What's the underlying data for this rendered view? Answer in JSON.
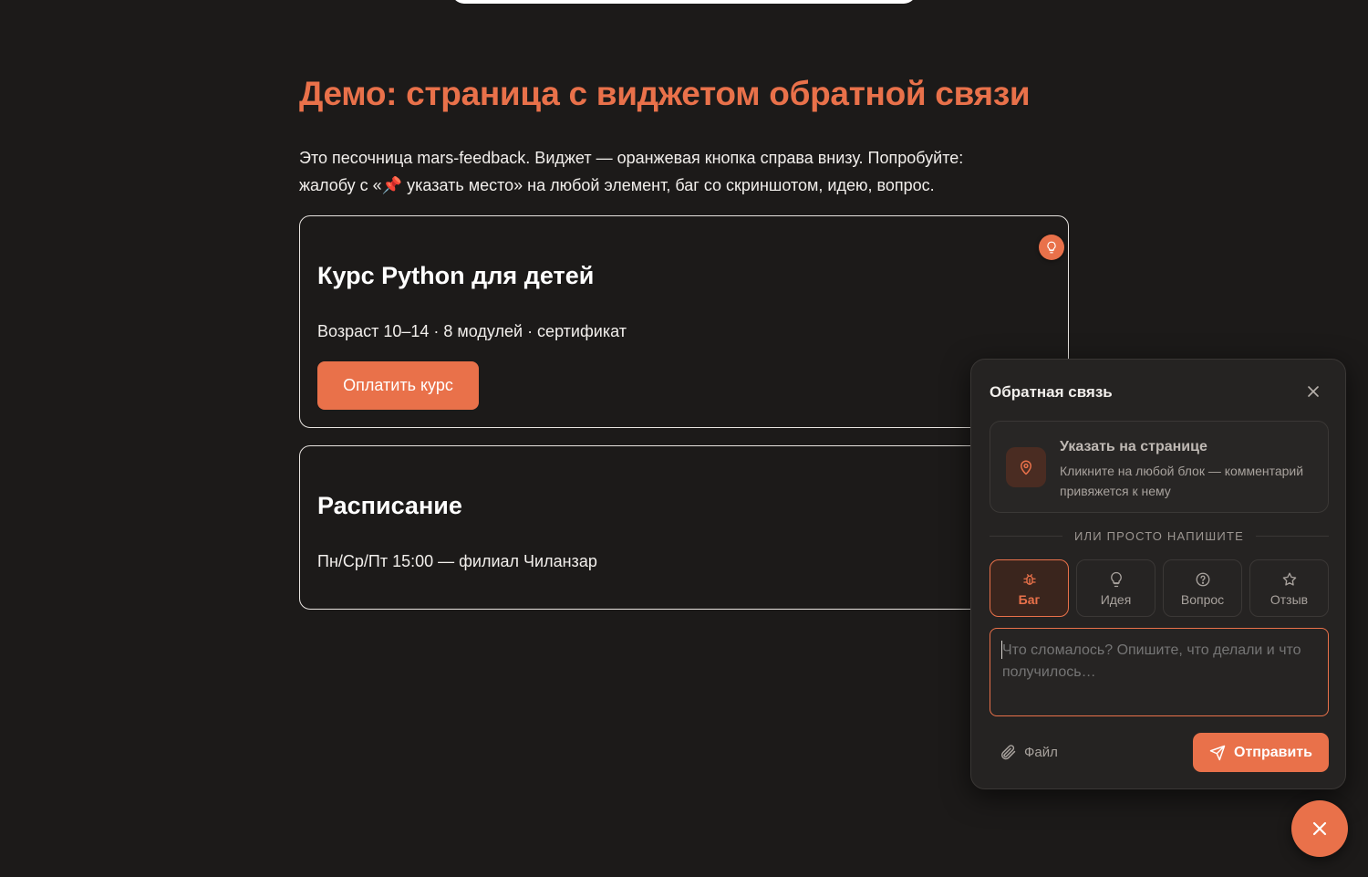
{
  "page": {
    "title": "Демо: страница с виджетом обратной связи",
    "intro_line1": "Это песочница mars-feedback. Виджет — оранжевая кнопка справа внизу. Попробуйте:",
    "intro_line2_a": "жалобу с «",
    "intro_pin": "📌",
    "intro_line2_b": " указать место» на любой элемент, баг со скриншотом, идею, вопрос."
  },
  "cards": {
    "course": {
      "title": "Курс Python для детей",
      "details": "Возраст 10–14 · 8 модулей · сертификат",
      "button_label": "Оплатить курс",
      "marker_icon": "lightbulb-icon"
    },
    "schedule": {
      "title": "Расписание",
      "details": "Пн/Ср/Пт 15:00 — филиал Чиланзар"
    }
  },
  "widget": {
    "title": "Обратная связь",
    "pick": {
      "title": "Указать на странице",
      "description": "Кликните на любой блок — комментарий привяжется к нему"
    },
    "divider": "ИЛИ ПРОСТО НАПИШИТЕ",
    "types": [
      {
        "label": "Баг",
        "icon": "bug-icon",
        "active": true
      },
      {
        "label": "Идея",
        "icon": "lightbulb-icon",
        "active": false
      },
      {
        "label": "Вопрос",
        "icon": "question-icon",
        "active": false
      },
      {
        "label": "Отзыв",
        "icon": "star-icon",
        "active": false
      }
    ],
    "message": {
      "value": "",
      "placeholder": "Что сломалось? Опишите, что делали и что получилось…"
    },
    "file_label": "Файл",
    "send_label": "Отправить"
  },
  "colors": {
    "accent": "#e9714a",
    "background": "#1c1a19",
    "panel": "#252322"
  }
}
